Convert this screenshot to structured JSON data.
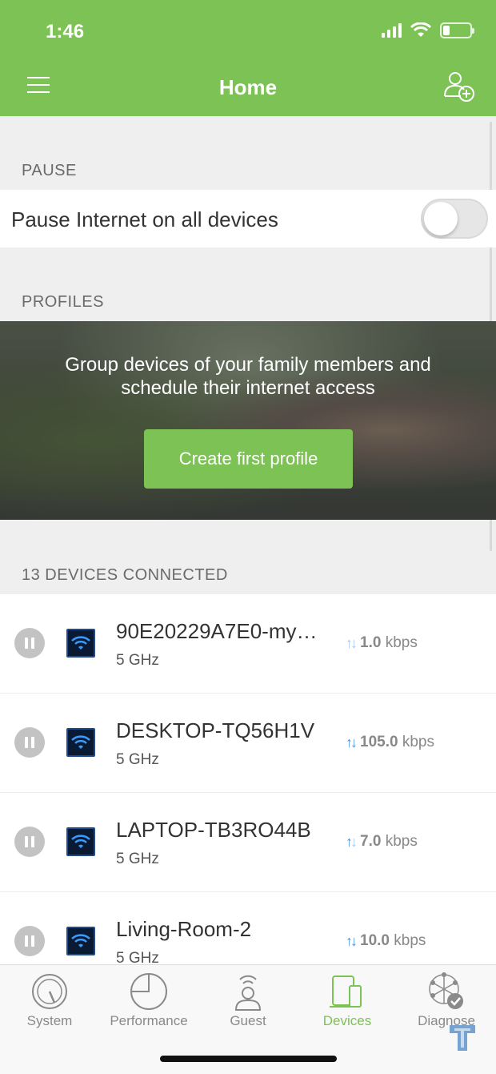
{
  "status_bar": {
    "time": "1:46"
  },
  "header": {
    "title": "Home"
  },
  "pause_section": {
    "label": "PAUSE",
    "row_text": "Pause Internet on all devices",
    "toggle_on": false
  },
  "profiles_section": {
    "label": "PROFILES",
    "banner_text": "Group devices of your family members and schedule their internet access",
    "button_label": "Create first profile"
  },
  "devices_section": {
    "label": "13 DEVICES CONNECTED",
    "devices": [
      {
        "name": "90E20229A7E0-my…",
        "band": "5 GHz",
        "rate": "1.0",
        "unit": "kbps"
      },
      {
        "name": "DESKTOP-TQ56H1V",
        "band": "5 GHz",
        "rate": "105.0",
        "unit": "kbps"
      },
      {
        "name": "LAPTOP-TB3RO44B",
        "band": "5 GHz",
        "rate": "7.0",
        "unit": "kbps"
      },
      {
        "name": "Living-Room-2",
        "band": "5 GHz",
        "rate": "10.0",
        "unit": "kbps"
      }
    ]
  },
  "tabbar": {
    "tabs": [
      {
        "label": "System",
        "icon": "gauge-icon"
      },
      {
        "label": "Performance",
        "icon": "pie-chart-icon"
      },
      {
        "label": "Guest",
        "icon": "guest-wifi-icon"
      },
      {
        "label": "Devices",
        "icon": "devices-icon",
        "active": true
      },
      {
        "label": "Diagnose",
        "icon": "network-check-icon"
      }
    ]
  },
  "colors": {
    "accent": "#7cc254",
    "inactive_tab": "#8a8a8a",
    "arrow_up": "#a6c8ee",
    "arrow_down": "#4a90e2"
  }
}
